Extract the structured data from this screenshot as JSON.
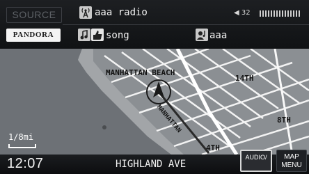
{
  "header": {
    "source_label": "SOURCE",
    "service_label": "PANDORA",
    "station": "aaa radio",
    "song": "song",
    "artist": "aaa",
    "volume": "32"
  },
  "map": {
    "labels": {
      "beach": "MANHATTAN BEACH",
      "street_14th": "14TH",
      "street_8th": "8TH",
      "street_4th": "4TH",
      "diagonal": "MANHATTAN"
    },
    "scale": "1/8mi"
  },
  "footer": {
    "time": "12:07",
    "street": "HIGHLAND AVE",
    "audio_label": "AUDIO/",
    "map_menu_line1": "MAP",
    "map_menu_line2": "MENU"
  },
  "icons": {
    "station": "radio-tower-icon",
    "song": "music-note-thumb-icon",
    "artist": "artist-icon",
    "volume": "speaker-icon",
    "position": "vehicle-arrow-icon"
  }
}
